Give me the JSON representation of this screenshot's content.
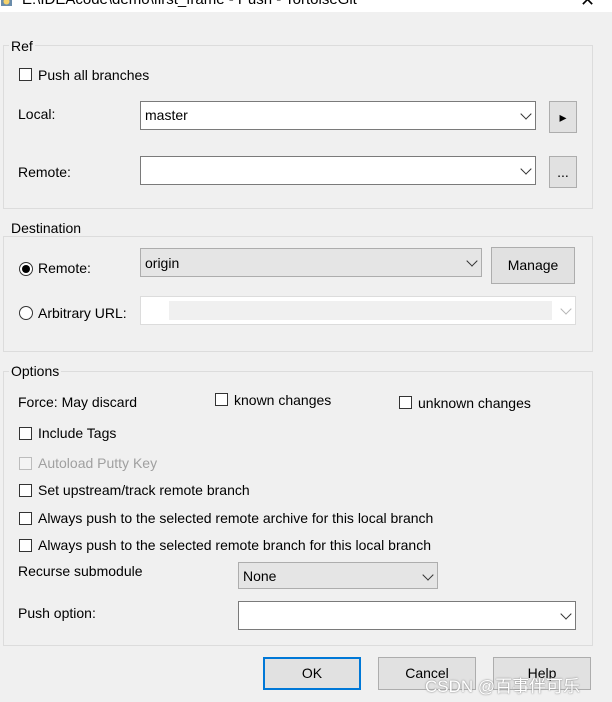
{
  "window": {
    "title": "E:\\IDEAcode\\demo\\first_frame - Push - TortoiseGit",
    "close_glyph": "✕"
  },
  "ref": {
    "group_label": "Ref",
    "push_all_branches": {
      "label": "Push all branches",
      "checked": false
    },
    "local_label": "Local:",
    "local_value": "master",
    "local_button_glyph": "▸",
    "remote_label": "Remote:",
    "remote_value": "",
    "remote_browse_label": "..."
  },
  "destination": {
    "group_label": "Destination",
    "remote_radio": {
      "label": "Remote:",
      "checked": true
    },
    "remote_value": "origin",
    "manage_label": "Manage",
    "url_radio": {
      "label": "Arbitrary URL:",
      "checked": false
    },
    "url_value": ""
  },
  "options": {
    "group_label": "Options",
    "force_label": "Force: May discard",
    "known_changes": {
      "label": "known changes",
      "checked": false
    },
    "unknown_changes": {
      "label": "unknown changes",
      "checked": false
    },
    "include_tags": {
      "label": "Include Tags",
      "checked": false
    },
    "autoload_putty": {
      "label": "Autoload Putty Key",
      "checked": false,
      "enabled": false
    },
    "set_upstream": {
      "label": "Set upstream/track remote branch",
      "checked": false
    },
    "always_push_archive": {
      "label": "Always push to the selected remote archive for this local branch",
      "checked": false
    },
    "always_push_branch": {
      "label": "Always push to the selected remote branch for this local branch",
      "checked": false
    },
    "recurse_label": "Recurse submodule",
    "recurse_value": "None",
    "push_option_label": "Push option:",
    "push_option_value": ""
  },
  "buttons": {
    "ok": "OK",
    "cancel": "Cancel",
    "help": "Help"
  },
  "watermark": "CSDN @百事伴可乐",
  "colors": {
    "accent": "#0078d7",
    "background": "#f0f0f0"
  }
}
